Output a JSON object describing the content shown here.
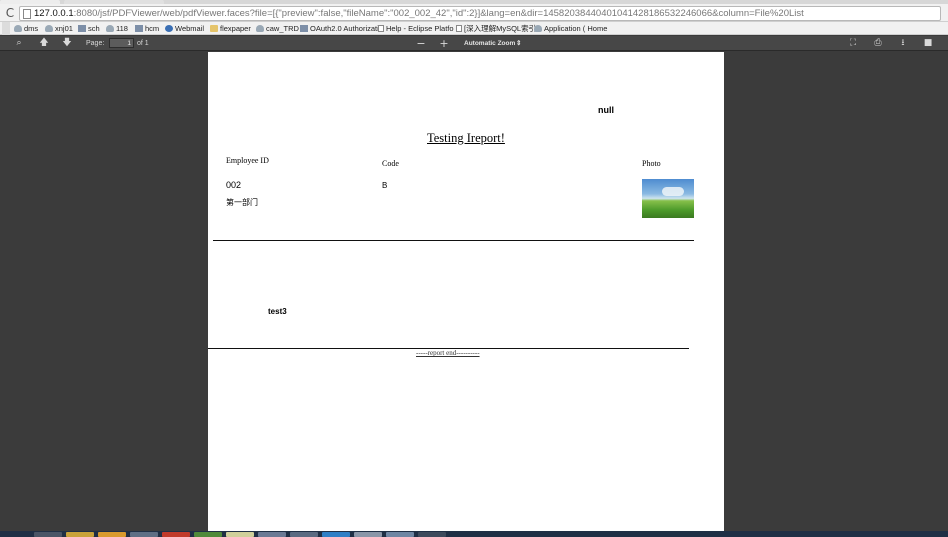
{
  "browser": {
    "url_host": "127.0.0.1",
    "url_rest": ":8080/jsf/PDFViewer/web/pdfViewer.faces?file=[{\"preview\":false,\"fileName\":\"002_002_42\",\"id\":2}]&lang=en&dir=14582038440401041428186532246066&column=File%20List",
    "reload_icon": "reload-icon"
  },
  "bookmarks": [
    {
      "label": "dms",
      "icon": "cloud-icon"
    },
    {
      "label": "xnj01",
      "icon": "cloud-icon"
    },
    {
      "label": "sch",
      "icon": "grid-icon"
    },
    {
      "label": "118",
      "icon": "cloud-icon"
    },
    {
      "label": "hcm",
      "icon": "grid-icon"
    },
    {
      "label": "Webmail",
      "icon": "globe-icon"
    },
    {
      "label": "flexpaper",
      "icon": "folder-icon"
    },
    {
      "label": "caw_TRD",
      "icon": "cloud-icon"
    },
    {
      "label": "OAuth2.0 Authorizatio",
      "icon": "grid-icon"
    },
    {
      "label": "Help - Eclipse Platfo",
      "icon": "doc-icon"
    },
    {
      "label": "[深入理解MySQL索引",
      "icon": "doc-icon"
    },
    {
      "label": "Application ( Home",
      "icon": "cloud-icon"
    }
  ],
  "pdf_toolbar": {
    "page_label": "Page:",
    "page_value": "1",
    "page_of": "of 1",
    "zoom_label": "Automatic Zoom",
    "zoom_arrow": "⇕"
  },
  "report": {
    "null_text": "null",
    "title": "Testing Ireport!",
    "col_employee": "Employee ID",
    "col_code": "Code",
    "col_photo": "Photo",
    "employee_id": "002",
    "department": "第一部门",
    "code": "B",
    "summary": "test3",
    "footer": "-----report end----------"
  },
  "colors": {
    "toolbar_bg": "#474747",
    "viewer_bg": "#3b3b3b",
    "page_bg": "#ffffff",
    "url_host_color": "#111111"
  }
}
